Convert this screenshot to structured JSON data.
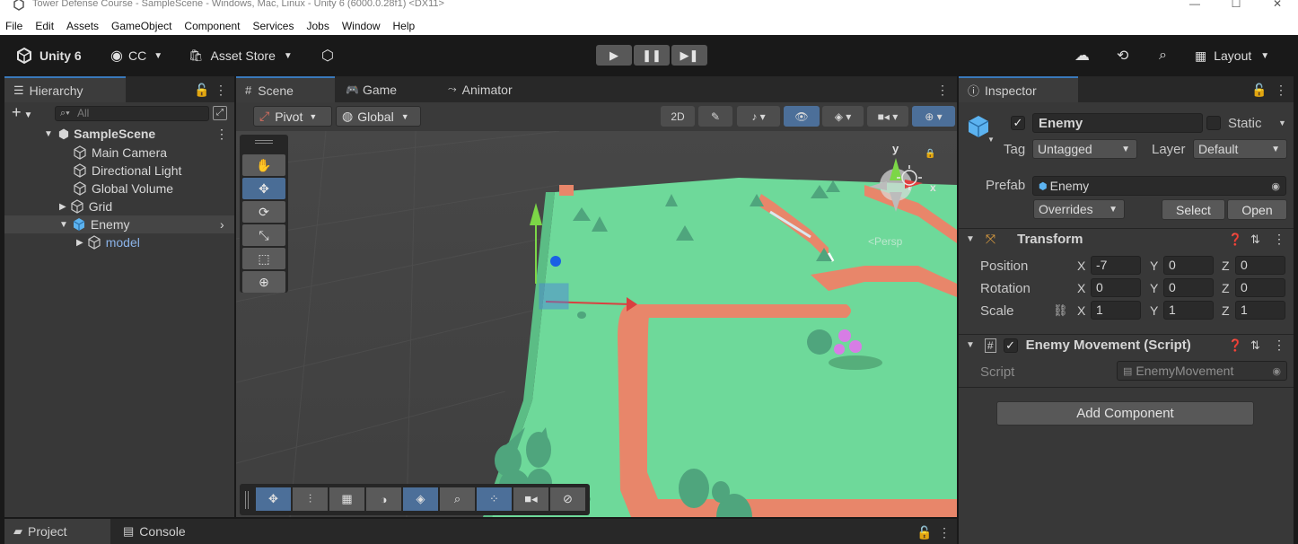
{
  "window": {
    "title": "Tower Defense Course - SampleScene - Windows, Mac, Linux - Unity 6 (6000.0.28f1) <DX11>",
    "controls": [
      "—",
      "☐",
      "✕"
    ]
  },
  "menu": [
    "File",
    "Edit",
    "Assets",
    "GameObject",
    "Component",
    "Services",
    "Jobs",
    "Window",
    "Help"
  ],
  "toolbar": {
    "brand": "Unity 6",
    "account": "CC",
    "asset_store": "Asset Store",
    "layout": "Layout"
  },
  "hierarchy": {
    "tab": "Hierarchy",
    "search_placeholder": "All",
    "scene": "SampleScene",
    "items": [
      {
        "label": "Main Camera"
      },
      {
        "label": "Directional Light"
      },
      {
        "label": "Global Volume"
      },
      {
        "label": "Grid"
      },
      {
        "label": "Enemy"
      },
      {
        "label": "model"
      }
    ]
  },
  "scene_view": {
    "tabs": [
      "Scene",
      "Game",
      "Animator"
    ],
    "pivot": "Pivot",
    "global": "Global",
    "gizmo_axis_y": "y",
    "gizmo_axis_x": "x",
    "persp_label": "<Persp"
  },
  "inspector": {
    "tab": "Inspector",
    "object_name": "Enemy",
    "static_label": "Static",
    "tag_label": "Tag",
    "tag_value": "Untagged",
    "layer_label": "Layer",
    "layer_value": "Default",
    "prefab_label": "Prefab",
    "prefab_value": "Enemy",
    "overrides": "Overrides",
    "select": "Select",
    "open": "Open",
    "transform": {
      "title": "Transform",
      "position_label": "Position",
      "rotation_label": "Rotation",
      "scale_label": "Scale",
      "axes": [
        "X",
        "Y",
        "Z"
      ],
      "position": [
        "-7",
        "0",
        "0"
      ],
      "rotation": [
        "0",
        "0",
        "0"
      ],
      "scale": [
        "1",
        "1",
        "1"
      ]
    },
    "script_component": {
      "title": "Enemy Movement (Script)",
      "script_label": "Script",
      "script_value": "EnemyMovement"
    },
    "add_component": "Add Component"
  },
  "bottom": {
    "tabs": [
      "Project",
      "Console"
    ]
  },
  "colors": {
    "accent": "#3a79bb",
    "ground": "#6ed99a",
    "path": "#e8866a",
    "tree": "#4fa57d"
  }
}
